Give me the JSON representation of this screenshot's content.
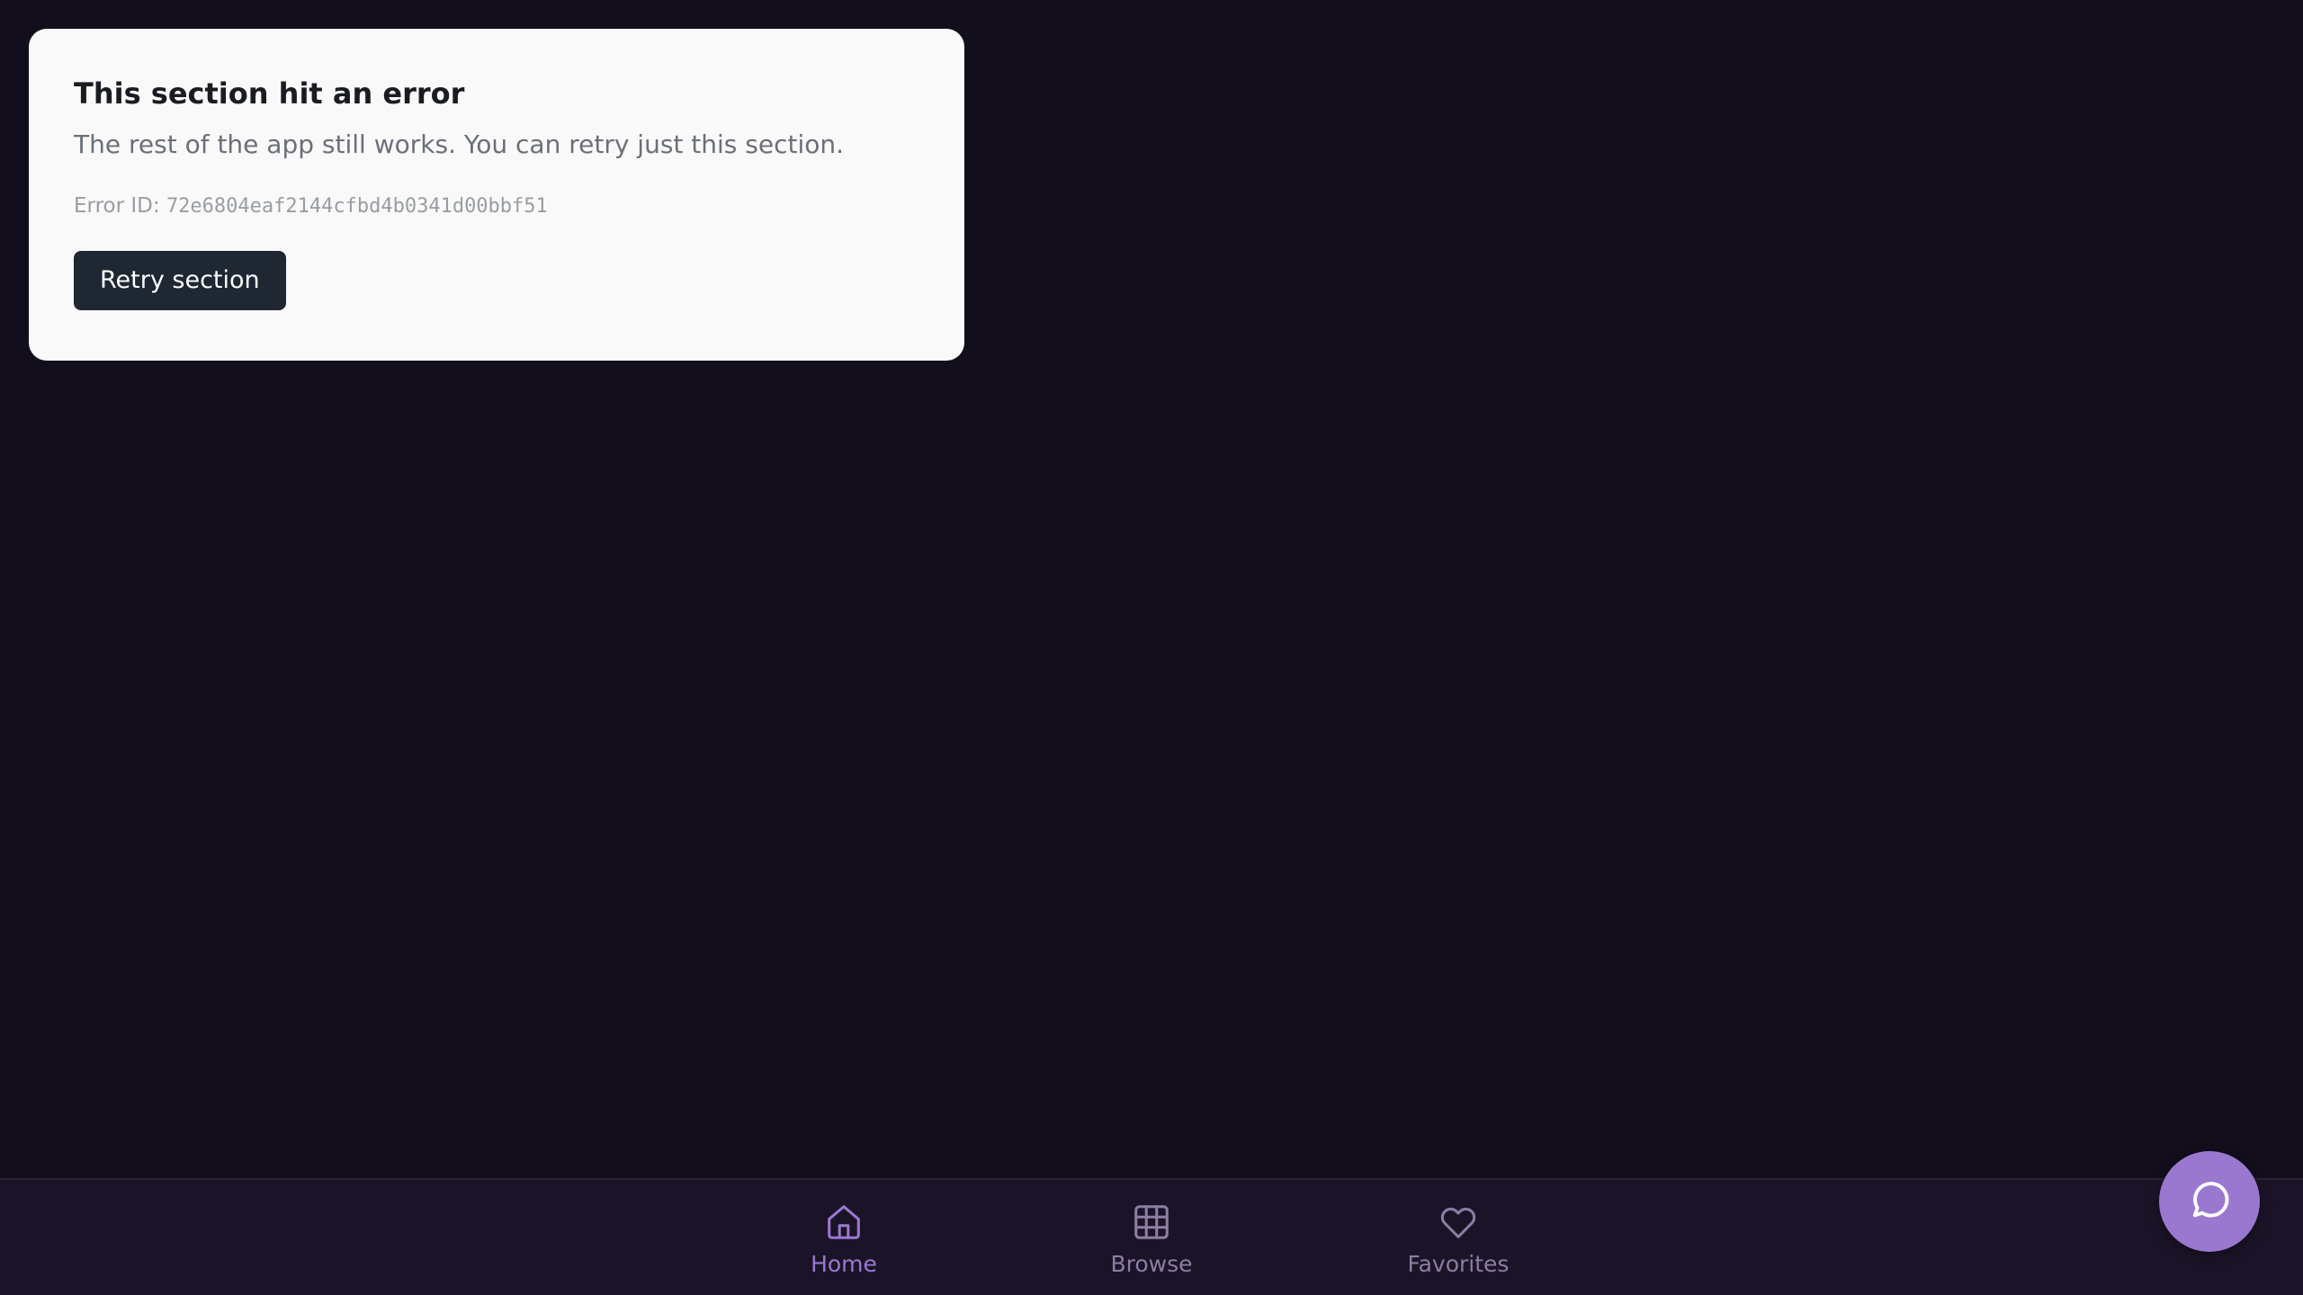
{
  "error_card": {
    "title": "This section hit an error",
    "description": "The rest of the app still works. You can retry just this section.",
    "error_id_label": "Error ID: ",
    "error_id_value": "72e6804eaf2144cfbd4b0341d00bbf51",
    "retry_label": "Retry section"
  },
  "bottom_nav": {
    "items": [
      {
        "label": "Home",
        "icon": "home-icon",
        "active": true
      },
      {
        "label": "Browse",
        "icon": "grid-icon",
        "active": false
      },
      {
        "label": "Favorites",
        "icon": "heart-icon",
        "active": false
      }
    ]
  },
  "fab": {
    "icon": "chat-icon"
  },
  "colors": {
    "background": "#120e1c",
    "card": "#f9f9f9",
    "button": "#1f2733",
    "nav_background": "#1b1428",
    "accent_active": "#9a78d0",
    "nav_inactive": "#8a7ea3"
  }
}
